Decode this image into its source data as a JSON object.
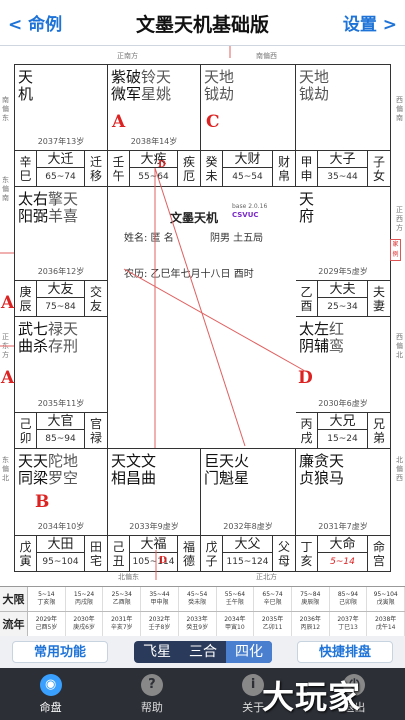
{
  "nav": {
    "back": "< 命例",
    "title": "文墨天机基础版",
    "settings": "设置 >"
  },
  "directions": {
    "top_left": "正南方",
    "top_right": "南偏西",
    "left_1": "南偏东",
    "left_2": "东偏南",
    "left_3": "正东方",
    "left_4": "东偏北",
    "right_1": "西偏南",
    "right_2": "正西方",
    "right_3": "西偏北",
    "right_4": "北偏西",
    "bottom_left": "北偏东",
    "bottom_right": "正北方"
  },
  "palaces": [
    {
      "id": "si",
      "main": [
        "天机"
      ],
      "minor": [],
      "age": "2038年14岁",
      "gz": [
        "辛",
        "巳"
      ],
      "name": "大迁",
      "range": "65~74",
      "sub": [
        "迁",
        "移"
      ]
    },
    {
      "id": "wu",
      "main": [
        "紫破",
        "微军"
      ],
      "minor": [
        "铃天",
        "星姚"
      ],
      "age": "2038年14岁",
      "gz": [
        "壬",
        "午"
      ],
      "name": "大疾",
      "range": "55~64",
      "sub": [
        "疾",
        "厄"
      ]
    },
    {
      "id": "wei",
      "main": [],
      "minor": [
        "天地",
        "钺劫"
      ],
      "age": "",
      "gz": [
        "癸",
        "未"
      ],
      "name": "大财",
      "range": "45~54",
      "sub": [
        "财",
        "帛"
      ]
    },
    {
      "id": "shen",
      "main": [],
      "minor": [
        "天地",
        "钺劫"
      ],
      "age": "",
      "gz": [
        "甲",
        "申"
      ],
      "name": "大子",
      "range": "35~44",
      "sub": [
        "子",
        "女"
      ]
    },
    {
      "id": "chen",
      "main": [
        "太右",
        "阳弼"
      ],
      "minor": [
        "擎天",
        "羊喜"
      ],
      "age": "2036年12岁",
      "gz": [
        "庚",
        "辰"
      ],
      "name": "大友",
      "range": "75~84",
      "sub": [
        "交",
        "友"
      ]
    },
    {
      "id": "you",
      "main": [
        "天府"
      ],
      "minor": [],
      "age": "2029年5虚岁",
      "gz": [
        "乙",
        "酉"
      ],
      "name": "大夫",
      "range": "25~34",
      "sub": [
        "夫",
        "妻"
      ]
    },
    {
      "id": "mao",
      "main": [
        "武七",
        "曲杀"
      ],
      "minor": [
        "禄天",
        "存刑"
      ],
      "age": "2035年11岁",
      "gz": [
        "己",
        "卯"
      ],
      "name": "大官",
      "range": "85~94",
      "sub": [
        "官",
        "禄"
      ]
    },
    {
      "id": "xu",
      "main": [
        "太左",
        "阴辅"
      ],
      "minor": [
        "红",
        "鸾"
      ],
      "age": "2030年6虚岁",
      "gz": [
        "丙",
        "戌"
      ],
      "name": "大兄",
      "range": "15~24",
      "sub": [
        "兄",
        "弟"
      ]
    },
    {
      "id": "yin",
      "main": [
        "天天",
        "同梁"
      ],
      "minor": [
        "陀地",
        "罗空"
      ],
      "age": "2034年10岁",
      "gz": [
        "戊",
        "寅"
      ],
      "name": "大田",
      "range": "95~104",
      "sub": [
        "田",
        "宅"
      ]
    },
    {
      "id": "chou",
      "main": [
        "天文文",
        "相昌曲"
      ],
      "minor": [],
      "age": "2033年9虚岁",
      "gz": [
        "己",
        "丑"
      ],
      "name": "大福",
      "range": "105~114",
      "sub": [
        "福",
        "德"
      ]
    },
    {
      "id": "zi",
      "main": [
        "巨天火",
        "门魁星"
      ],
      "minor": [],
      "age": "2032年8虚岁",
      "gz": [
        "戊",
        "子"
      ],
      "name": "大父",
      "range": "115~124",
      "sub": [
        "父",
        "母"
      ]
    },
    {
      "id": "hai",
      "main": [
        "廉贪天",
        "贞狼马"
      ],
      "minor": [],
      "age": "2031年7虚岁",
      "gz": [
        "丁",
        "亥"
      ],
      "name": "大命",
      "range": "5~14",
      "sub": [
        "命",
        "宫"
      ]
    }
  ],
  "ages": {
    "si": "2037年13岁",
    "wu": "2038年14岁",
    "chen": "2036年12岁",
    "you": "2029年5虚岁",
    "mao": "2035年11岁",
    "xu": "2030年6虚岁",
    "yin": "2034年10岁",
    "chou": "2033年9虚岁",
    "zi": "2032年8虚岁",
    "hai": "2031年7虚岁"
  },
  "letters": {
    "A1": "A",
    "A2": "A",
    "A3": "A",
    "B": "B",
    "C1": "C",
    "C2": "C",
    "D1": "D",
    "D2": "D",
    "D3": "D"
  },
  "center": {
    "title": "文墨天机",
    "version": "base 2.0.16",
    "csvuc": "CSVUC",
    "name": "姓名: 匿 名",
    "gender": "阴男  土五局",
    "lunar": "农历: 乙巳年七月十八日 酉时"
  },
  "seal": "家例",
  "colors": {
    "accent": "#1e73d8",
    "letter": "#d22222",
    "lines": "#e06060",
    "tabbar": "#2c2f36"
  },
  "daxian": {
    "label": "大限",
    "cells": [
      [
        "5~14",
        "丁亥限"
      ],
      [
        "15~24",
        "丙戌限"
      ],
      [
        "25~34",
        "乙酉限"
      ],
      [
        "35~44",
        "甲申限"
      ],
      [
        "45~54",
        "癸未限"
      ],
      [
        "55~64",
        "壬午限"
      ],
      [
        "65~74",
        "辛巳限"
      ],
      [
        "75~84",
        "庚辰限"
      ],
      [
        "85~94",
        "己卯限"
      ],
      [
        "95~104",
        "戊寅限"
      ]
    ]
  },
  "liunian": {
    "label": "流年",
    "cells": [
      [
        "2029年",
        "己酉5岁"
      ],
      [
        "2030年",
        "庚戌6岁"
      ],
      [
        "2031年",
        "辛亥7岁"
      ],
      [
        "2032年",
        "壬子8岁"
      ],
      [
        "2033年",
        "癸丑9岁"
      ],
      [
        "2034年",
        "甲寅10"
      ],
      [
        "2035年",
        "乙卯11"
      ],
      [
        "2036年",
        "丙辰12"
      ],
      [
        "2037年",
        "丁巳13"
      ],
      [
        "2038年",
        "戊午14"
      ]
    ]
  },
  "actions": {
    "left": "常用功能",
    "seg": [
      "飞星",
      "三合",
      "四化"
    ],
    "right": "快捷排盘"
  },
  "tabs": [
    {
      "label": "命盘",
      "icon": "◉"
    },
    {
      "label": "帮助",
      "icon": "?"
    },
    {
      "label": "关于",
      "icon": "i"
    },
    {
      "label": "退出",
      "icon": "⏻"
    }
  ],
  "watermark": "大玩家"
}
